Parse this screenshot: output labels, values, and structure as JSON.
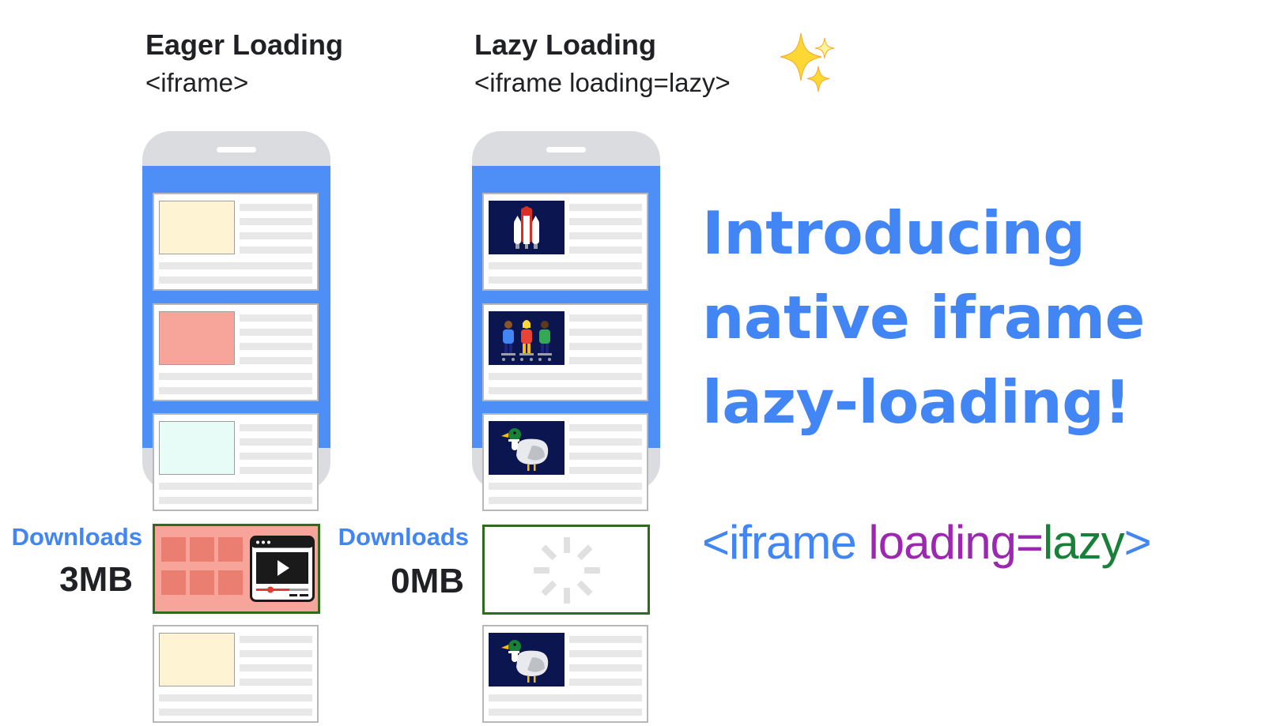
{
  "eager": {
    "title": "Eager Loading",
    "tag": "<iframe>",
    "downloads_label": "Downloads",
    "downloads_size": "3MB"
  },
  "lazy": {
    "title": "Lazy Loading",
    "tag": "<iframe loading=lazy>",
    "downloads_label": "Downloads",
    "downloads_size": "0MB"
  },
  "headline": {
    "line1": "Introducing",
    "line2": "native iframe",
    "line3": "lazy-loading!"
  },
  "code": {
    "open": "<iframe",
    "attr": "loading=",
    "value": "lazy",
    "close": ">"
  },
  "colors": {
    "blue": "#4285f4",
    "purple": "#9c27b0",
    "green": "#188038",
    "phone_screen": "#4d8ff7",
    "loaded_frame_border": "#2e6b1f",
    "thumb_yellow": "#fef3d2",
    "thumb_red": "#f7a59b",
    "thumb_cyan": "#e7fcf6",
    "lazy_thumb_bg": "#0b1650"
  },
  "icons": [
    "sparkles-icon",
    "rocket-icon",
    "people-icon",
    "duck-icon",
    "video-player-icon",
    "loading-spinner-icon"
  ]
}
